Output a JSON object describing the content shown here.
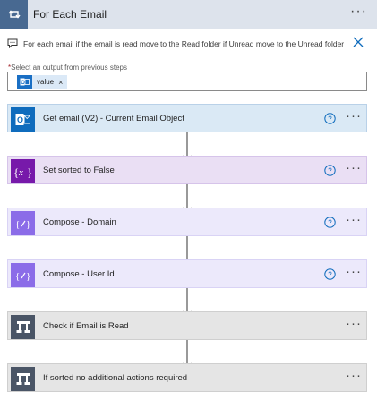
{
  "loop": {
    "title": "For Each Email",
    "more": "···",
    "comment": "For each email if the email is read move to the Read folder if Unread move to the Unread folder",
    "output_label": "Select an output from previous steps",
    "output_required_mark": "*",
    "token": {
      "label": "value",
      "remove": "×"
    }
  },
  "actions": [
    {
      "title": "Get email (V2) - Current Email Object",
      "icon": "outlook-icon",
      "help": true
    },
    {
      "title": "Set sorted to False",
      "icon": "variable-icon",
      "help": true
    },
    {
      "title": "Compose - Domain",
      "icon": "compose-icon",
      "help": true
    },
    {
      "title": "Compose - User Id",
      "icon": "compose-icon",
      "help": true
    },
    {
      "title": "Check if Email is Read",
      "icon": "condition-icon",
      "help": false
    },
    {
      "title": "If sorted no additional actions required",
      "icon": "condition-icon",
      "help": false
    }
  ],
  "more_glyph": "···",
  "colors": {
    "header_bg": "#dde3ec",
    "loop_icon": "#486991",
    "outlook": "#0f6cbd",
    "variable": "#7719aa",
    "compose": "#8b6ce8",
    "condition": "#4a5566"
  }
}
